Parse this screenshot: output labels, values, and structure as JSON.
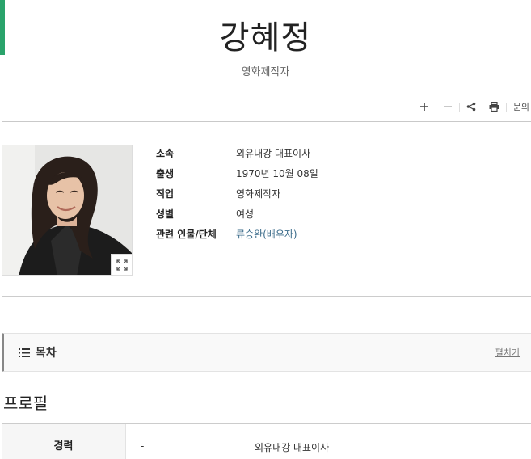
{
  "person": {
    "name": "강혜정",
    "occupation_subtitle": "영화제작자"
  },
  "toolbar": {
    "zoom_in_icon": "plus-icon",
    "zoom_out_icon": "minus-icon",
    "share_icon": "share-icon",
    "print_icon": "printer-icon",
    "inquiry_label": "문의"
  },
  "photo": {
    "expand_icon": "expand-icon"
  },
  "info": {
    "rows": [
      {
        "label": "소속",
        "value": "외유내강 대표이사"
      },
      {
        "label": "출생",
        "value": "1970년 10월 08일"
      },
      {
        "label": "직업",
        "value": "영화제작자"
      },
      {
        "label": "성별",
        "value": "여성"
      },
      {
        "label": "관련 인물/단체",
        "value": "류승완(배우자)"
      }
    ]
  },
  "toc": {
    "title": "목차",
    "toggle_label": "펼치기"
  },
  "profile": {
    "section_title": "프로필",
    "career": {
      "label": "경력",
      "period": "-",
      "description": "외유내강 대표이사"
    }
  },
  "colors": {
    "accent": "#2aa36b",
    "link": "#3a6b8a"
  }
}
